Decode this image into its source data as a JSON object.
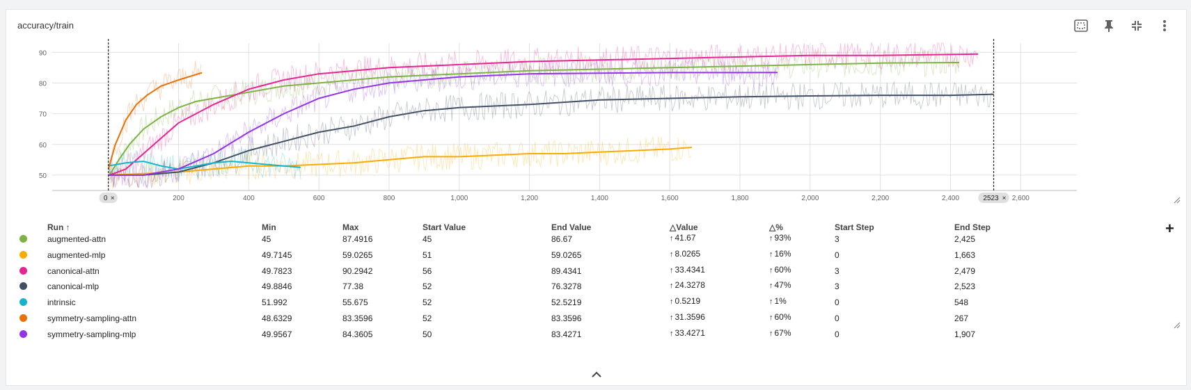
{
  "card": {
    "title": "accuracy/train"
  },
  "toolbar": [
    {
      "name": "fit-domain-icon"
    },
    {
      "name": "pin-icon"
    },
    {
      "name": "collapse-icon"
    },
    {
      "name": "more-vert-icon"
    }
  ],
  "chart_data": {
    "type": "line",
    "xlim": [
      -160,
      2760
    ],
    "ylim": [
      45,
      93
    ],
    "xticks": [
      {
        "v": 0,
        "label": "0"
      },
      {
        "v": 200,
        "label": "200"
      },
      {
        "v": 400,
        "label": "400"
      },
      {
        "v": 600,
        "label": "600"
      },
      {
        "v": 800,
        "label": "800"
      },
      {
        "v": 1000,
        "label": "1,000"
      },
      {
        "v": 1200,
        "label": "1,200"
      },
      {
        "v": 1400,
        "label": "1,400"
      },
      {
        "v": 1600,
        "label": "1,600"
      },
      {
        "v": 1800,
        "label": "1,800"
      },
      {
        "v": 2000,
        "label": "2,000"
      },
      {
        "v": 2200,
        "label": "2,200"
      },
      {
        "v": 2400,
        "label": "2,400"
      },
      {
        "v": 2600,
        "label": "2,600"
      }
    ],
    "yticks": [
      50,
      60,
      70,
      80,
      90
    ],
    "range_markers": [
      {
        "step": 0,
        "label": "0"
      },
      {
        "step": 2523,
        "label": "2523"
      }
    ],
    "grid": true,
    "series": [
      {
        "name": "augmented-attn",
        "color": "#7cb342",
        "x": [
          3,
          30,
          60,
          100,
          150,
          200,
          250,
          300,
          350,
          400,
          500,
          600,
          700,
          800,
          900,
          1000,
          1100,
          1200,
          1400,
          1600,
          1800,
          2000,
          2200,
          2425
        ],
        "y": [
          50,
          55,
          60,
          65,
          69,
          72,
          74,
          75,
          76,
          77,
          79,
          80,
          81,
          82,
          82.5,
          83,
          83.5,
          84,
          84.5,
          85,
          85.5,
          86,
          86.5,
          86.67
        ]
      },
      {
        "name": "augmented-mlp",
        "color": "#f9ab00",
        "x": [
          0,
          100,
          200,
          300,
          400,
          500,
          600,
          700,
          800,
          900,
          1000,
          1100,
          1200,
          1300,
          1400,
          1500,
          1600,
          1663
        ],
        "y": [
          50,
          50.5,
          51,
          52,
          53,
          53,
          53.5,
          54,
          55,
          56,
          56,
          56.5,
          57,
          57,
          57.5,
          58,
          58.5,
          59.03
        ]
      },
      {
        "name": "canonical-attn",
        "color": "#e52592",
        "x": [
          3,
          50,
          100,
          150,
          200,
          300,
          400,
          500,
          600,
          800,
          1000,
          1200,
          1400,
          1600,
          1800,
          2000,
          2200,
          2479
        ],
        "y": [
          50,
          52,
          57,
          62,
          67,
          73,
          78,
          81,
          83,
          85,
          86,
          87,
          87.5,
          88,
          88.5,
          89,
          89,
          89.43
        ]
      },
      {
        "name": "canonical-mlp",
        "color": "#425066",
        "x": [
          3,
          100,
          200,
          300,
          400,
          500,
          600,
          700,
          800,
          900,
          1000,
          1200,
          1400,
          1600,
          1800,
          2000,
          2200,
          2400,
          2523
        ],
        "y": [
          50,
          50,
          51,
          54,
          58,
          61,
          64,
          66,
          69,
          71,
          72,
          73,
          74.5,
          75,
          75.5,
          75.8,
          76,
          76,
          76.33
        ]
      },
      {
        "name": "intrinsic",
        "color": "#12b5cb",
        "x": [
          0,
          50,
          100,
          150,
          200,
          250,
          300,
          350,
          400,
          450,
          500,
          548
        ],
        "y": [
          53,
          54,
          54.5,
          53,
          52,
          53,
          54,
          54.5,
          54,
          53.5,
          53,
          52.52
        ]
      },
      {
        "name": "symmetry-sampling-attn",
        "color": "#e8710a",
        "x": [
          0,
          20,
          50,
          80,
          110,
          150,
          200,
          267
        ],
        "y": [
          52,
          60,
          68,
          73,
          76,
          79,
          81,
          83.36
        ]
      },
      {
        "name": "symmetry-sampling-mlp",
        "color": "#9334e6",
        "x": [
          0,
          100,
          200,
          300,
          400,
          500,
          600,
          700,
          800,
          1000,
          1200,
          1400,
          1600,
          1800,
          1907
        ],
        "y": [
          50,
          50,
          52,
          57,
          64,
          70,
          75,
          78,
          80,
          82,
          83,
          83.2,
          83.4,
          83.4,
          83.43
        ]
      }
    ]
  },
  "table": {
    "headers": {
      "run": "Run ↑",
      "min": "Min",
      "max": "Max",
      "start_value": "Start Value",
      "end_value": "End Value",
      "delta_value": "△Value",
      "delta_pct": "△%",
      "start_step": "Start Step",
      "end_step": "End Step"
    },
    "rows": [
      {
        "color": "#7cb342",
        "run": "augmented-attn",
        "min": "45",
        "max": "87.4916",
        "start_value": "45",
        "end_value": "86.67",
        "delta_value": "41.67",
        "delta_pct": "93%",
        "start_step": "3",
        "end_step": "2,425"
      },
      {
        "color": "#f9ab00",
        "run": "augmented-mlp",
        "min": "49.7145",
        "max": "59.0265",
        "start_value": "51",
        "end_value": "59.0265",
        "delta_value": "8.0265",
        "delta_pct": "16%",
        "start_step": "0",
        "end_step": "1,663"
      },
      {
        "color": "#e52592",
        "run": "canonical-attn",
        "min": "49.7823",
        "max": "90.2942",
        "start_value": "56",
        "end_value": "89.4341",
        "delta_value": "33.4341",
        "delta_pct": "60%",
        "start_step": "3",
        "end_step": "2,479"
      },
      {
        "color": "#425066",
        "run": "canonical-mlp",
        "min": "49.8846",
        "max": "77.38",
        "start_value": "52",
        "end_value": "76.3278",
        "delta_value": "24.3278",
        "delta_pct": "47%",
        "start_step": "3",
        "end_step": "2,523"
      },
      {
        "color": "#12b5cb",
        "run": "intrinsic",
        "min": "51.992",
        "max": "55.675",
        "start_value": "52",
        "end_value": "52.5219",
        "delta_value": "0.5219",
        "delta_pct": "1%",
        "start_step": "0",
        "end_step": "548"
      },
      {
        "color": "#e8710a",
        "run": "symmetry-sampling-attn",
        "min": "48.6329",
        "max": "83.3596",
        "start_value": "52",
        "end_value": "83.3596",
        "delta_value": "31.3596",
        "delta_pct": "60%",
        "start_step": "0",
        "end_step": "267"
      },
      {
        "color": "#9334e6",
        "run": "symmetry-sampling-mlp",
        "min": "49.9567",
        "max": "84.3605",
        "start_value": "50",
        "end_value": "83.4271",
        "delta_value": "33.4271",
        "delta_pct": "67%",
        "start_step": "0",
        "end_step": "1,907"
      }
    ],
    "add_label": "+",
    "up_arrow": "↑"
  }
}
